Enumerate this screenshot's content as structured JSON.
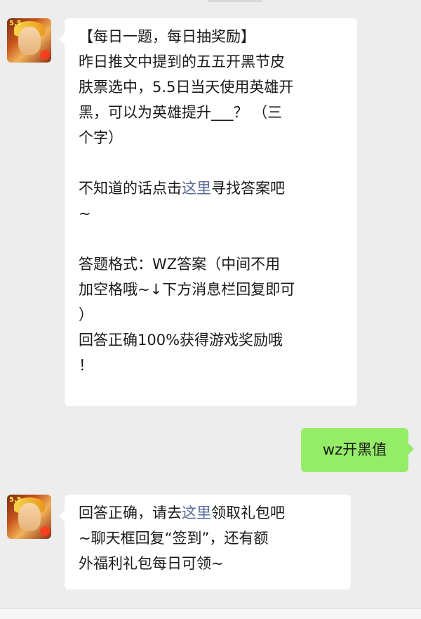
{
  "messages": [
    {
      "sender": "bot",
      "lines": [
        [
          "【每日一题，每日抽奖励】"
        ],
        [
          "昨日推文中提到的五五开黑节皮"
        ],
        [
          "肤票选中，5.5日当天使用英雄开"
        ],
        [
          "黑，可以为英雄提升___？ （三"
        ],
        [
          "个字）"
        ],
        [
          ""
        ],
        [
          "不知道的话点击",
          "这里",
          "寻找答案吧"
        ],
        [
          "~"
        ],
        [
          ""
        ],
        [
          "答题格式：WZ答案（中间不用"
        ],
        [
          "加空格哦~↓下方消息栏回复即可"
        ],
        [
          "）"
        ],
        [
          "回答正确100%获得游戏奖励哦"
        ],
        [
          "！"
        ]
      ]
    },
    {
      "sender": "user",
      "text": "wz开黑值"
    },
    {
      "sender": "bot",
      "lines": [
        [
          "回答正确，请去",
          "这里",
          "领取礼包吧"
        ],
        [
          "~聊天框回复“签到”，还有额"
        ],
        [
          "外福利礼包每日可领~"
        ]
      ]
    }
  ],
  "avatar": {
    "badge": "5.5"
  },
  "colors": {
    "background": "#ededed",
    "bubble_left": "#ffffff",
    "bubble_right": "#95ec69",
    "link": "#576b95"
  }
}
